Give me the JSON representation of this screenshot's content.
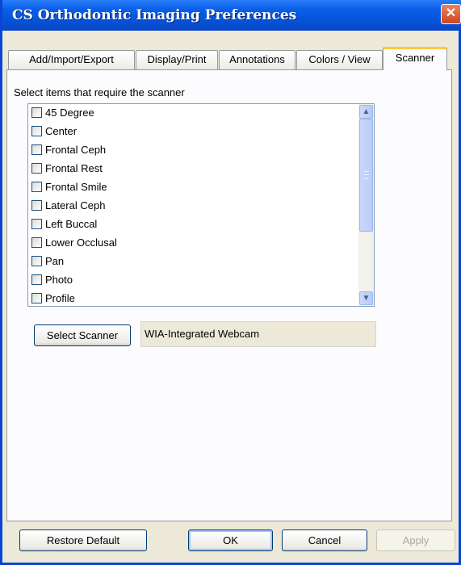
{
  "window": {
    "title": "CS Orthodontic Imaging Preferences",
    "close_glyph": "✕"
  },
  "tabs": [
    {
      "label": "Add/Import/Export"
    },
    {
      "label": "Display/Print"
    },
    {
      "label": "Annotations"
    },
    {
      "label": "Colors / View"
    },
    {
      "label": "Scanner",
      "active": true
    }
  ],
  "scanner_tab": {
    "instruction": "Select items that require the scanner",
    "items": [
      {
        "label": "45 Degree",
        "checked": false
      },
      {
        "label": "Center",
        "checked": false
      },
      {
        "label": "Frontal Ceph",
        "checked": false
      },
      {
        "label": "Frontal Rest",
        "checked": false
      },
      {
        "label": "Frontal Smile",
        "checked": false
      },
      {
        "label": "Lateral Ceph",
        "checked": false
      },
      {
        "label": "Left Buccal",
        "checked": false
      },
      {
        "label": "Lower Occlusal",
        "checked": false
      },
      {
        "label": "Pan",
        "checked": false
      },
      {
        "label": "Photo",
        "checked": false
      },
      {
        "label": "Profile",
        "checked": false
      }
    ],
    "select_scanner_label": "Select Scanner",
    "current_scanner": "WIA-Integrated Webcam"
  },
  "footer": {
    "restore_label": "Restore Default",
    "ok_label": "OK",
    "cancel_label": "Cancel",
    "apply_label": "Apply"
  }
}
